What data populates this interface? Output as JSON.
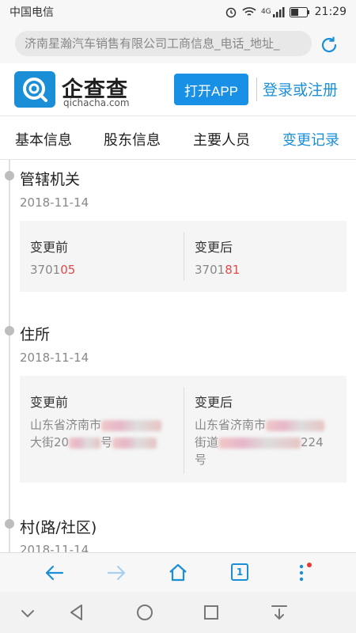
{
  "status_bar": {
    "carrier": "中国电信",
    "network": "4G",
    "time": "21:29"
  },
  "browser": {
    "url_text": "济南星瀚汽车销售有限公司工商信息_电话_地址_",
    "tab_count": "1"
  },
  "header": {
    "logo_cn": "企查查",
    "logo_en": "qichacha.com",
    "open_app": "打开APP",
    "login": "登录或注册"
  },
  "tabs": [
    {
      "label": "基本信息"
    },
    {
      "label": "股东信息"
    },
    {
      "label": "主要人员"
    },
    {
      "label": "变更记录"
    }
  ],
  "records": [
    {
      "title": "管辖机关",
      "date": "2018-11-14",
      "before_label": "变更前",
      "after_label": "变更后",
      "before_prefix": "370105",
      "before_plain": "3701",
      "before_red": "05",
      "after_plain": "3701",
      "after_red": "81"
    },
    {
      "title": "住所",
      "date": "2018-11-14",
      "before_label": "变更前",
      "after_label": "变更后",
      "before_line1": "山东省济南市",
      "before_line2_a": "大街20",
      "before_line2_b": "号",
      "after_line1": "山东省济南市",
      "after_line2": "街道",
      "after_line2_num": "224",
      "after_line3": "号"
    },
    {
      "title": "村(路/社区)",
      "date": "2018-11-14"
    }
  ],
  "colors": {
    "accent": "#1a8fd8",
    "red": "#e24a4a"
  }
}
